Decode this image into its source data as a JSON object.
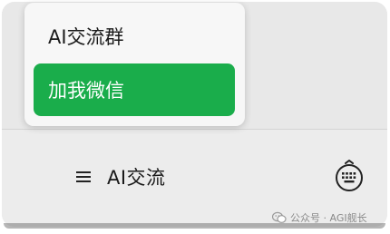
{
  "popup_menu": {
    "items": [
      {
        "label": "AI交流群",
        "selected": false
      },
      {
        "label": "加我微信",
        "selected": true
      }
    ]
  },
  "bottom_bar": {
    "menu_label": "AI交流",
    "menu_icon": "hamburger-icon",
    "keyboard_icon": "keyboard-icon"
  },
  "watermark": {
    "text": "公众号 · AGI舰长",
    "icon": "wechat-icon"
  },
  "colors": {
    "accent": "#1aad4b",
    "background": "#e9e9e9"
  }
}
